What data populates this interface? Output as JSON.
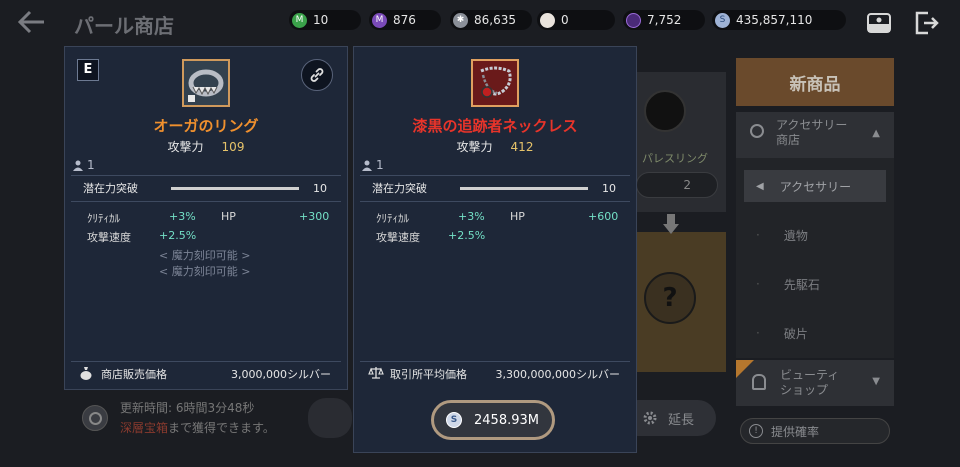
{
  "header": {
    "title": "パール商店",
    "currencies": [
      {
        "icon": "green-m-token-icon",
        "value": "10",
        "color": "#3aa14a",
        "glyph": "M"
      },
      {
        "icon": "purple-m-token-icon",
        "value": "876",
        "color": "#7a4ab8",
        "glyph": "M"
      },
      {
        "icon": "gear-token-icon",
        "value": "86,635",
        "color": "#8a8f98",
        "glyph": "✱"
      },
      {
        "icon": "pearl-icon",
        "value": "0",
        "color": "#e9e3dc",
        "glyph": ""
      },
      {
        "icon": "dark-orb-icon",
        "value": "7,752",
        "color": "#4a2a78",
        "glyph": ""
      },
      {
        "icon": "silver-coin-icon",
        "value": "435,857,110",
        "color": "#9fb3d6",
        "glyph": "S"
      }
    ]
  },
  "background": {
    "refresh_text": "更新時間: 6時間3分48秒",
    "obtain_red": "深層宝箱",
    "obtain_rest": "まで獲得できます。",
    "extend_label": "延長",
    "new_items_label": "新商品",
    "shop_group_label": "アクセサリー\n商店",
    "side_items": [
      "アクセサリー",
      "遺物",
      "先駆石",
      "破片"
    ],
    "beauty_shop_label": "ビューティ\nショップ",
    "odds_label": "提供確率",
    "faded_ring_label": "パレスリング",
    "faded_ring_count": "2"
  },
  "left_card": {
    "grade": "E",
    "name": "オーガのリング",
    "name_color": "#f0902e",
    "stat_label": "攻撃力",
    "stat_value": "109",
    "enhance": "1",
    "potential_label": "潜在力突破",
    "potential_value": "10",
    "options": [
      {
        "label": "ｸﾘﾃｨｶﾙ",
        "value": "+3%"
      },
      {
        "label": "HP",
        "value": "+300"
      },
      {
        "label": "攻撃速度",
        "value": "+2.5%"
      }
    ],
    "locked_1": "< 魔力刻印可能 >",
    "locked_2": "< 魔力刻印可能 >",
    "price_label": "商店販売価格",
    "price_value": "3,000,000シルバー"
  },
  "right_card": {
    "name": "漆黒の追跡者ネックレス",
    "name_color": "#e8342a",
    "stat_label": "攻撃力",
    "stat_value": "412",
    "enhance": "1",
    "potential_label": "潜在力突破",
    "potential_value": "10",
    "options": [
      {
        "label": "ｸﾘﾃｨｶﾙ",
        "value": "+3%"
      },
      {
        "label": "HP",
        "value": "+600"
      },
      {
        "label": "攻撃速度",
        "value": "+2.5%"
      }
    ],
    "price_label": "取引所平均価格",
    "price_value": "3,300,000,000シルバー"
  },
  "silver_display": "2458.93M"
}
